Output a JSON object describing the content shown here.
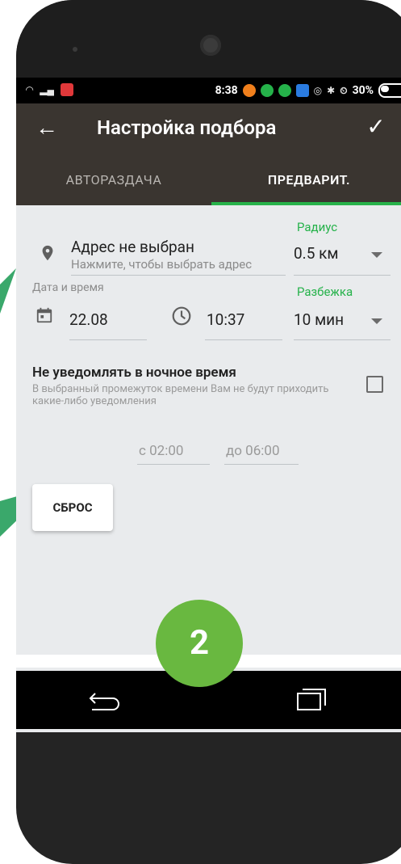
{
  "status_bar": {
    "time": "8:38",
    "battery": "30%"
  },
  "app_bar": {
    "title": "Настройка подбора"
  },
  "tabs": [
    {
      "label": "АВТОРАЗДАЧА",
      "active": false
    },
    {
      "label": "ПРЕДВАРИТ.",
      "active": true
    }
  ],
  "address": {
    "value": "Адрес не выбран",
    "hint": "Нажмите, чтобы выбрать адрес"
  },
  "radius": {
    "label": "Радиус",
    "value": "0.5 км"
  },
  "datetime": {
    "label": "Дата и время",
    "date": "22.08",
    "time": "10:37"
  },
  "spread": {
    "label": "Разбежка",
    "value": "10 мин"
  },
  "night_mode": {
    "title": "Не уведомлять в ночное время",
    "description": "В выбранный промежуток времени Вам не будут приходить какие-либо уведомления",
    "checked": false,
    "from": "с 02:00",
    "to": "до 06:00"
  },
  "reset_button": {
    "label": "СБРОС"
  },
  "badge": {
    "number": "2"
  },
  "colors": {
    "accent_green": "#25b24a",
    "appbar_brown": "#3a3530",
    "badge_green": "#69b840",
    "pointer_green": "#3aa86b"
  }
}
